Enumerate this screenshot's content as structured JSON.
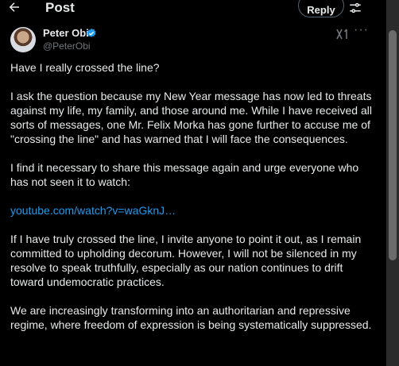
{
  "header": {
    "title": "Post",
    "reply_label": "Reply"
  },
  "author": {
    "name": "Peter Obi",
    "handle": "@PeterObi"
  },
  "post": {
    "paragraphs": [
      "Have I really crossed the line?",
      "I ask the question because my New Year message has now led to threats against my life, my family, and those around me. While I have received all sorts of messages, one Mr. Felix Morka has gone further to accuse me of \"crossing the line\" and has warned that I will face the consequences.",
      "I find it necessary to share this message again and urge everyone who has not seen it to watch:",
      "If I have truly crossed the line, I invite anyone to point it out, as I remain committed to upholding decorum. However, I will not be silenced in my resolve to speak truthfully, especially as our nation continues to drift toward undemocratic practices.",
      "We are increasingly transforming into an authoritarian and repressive regime, where freedom of expression is being systematically suppressed."
    ],
    "link_text": "youtube.com/watch?v=waGknJ…"
  },
  "icons": {
    "back": "back-arrow-icon",
    "adjust": "sliders-icon",
    "verified": "verified-badge-icon",
    "grok": "grok-icon",
    "more": "more-icon"
  },
  "colors": {
    "background": "#000000",
    "text": "#e7e9ea",
    "secondary": "#71767b",
    "link": "#1d9bf0",
    "verified": "#1d9bf0"
  }
}
